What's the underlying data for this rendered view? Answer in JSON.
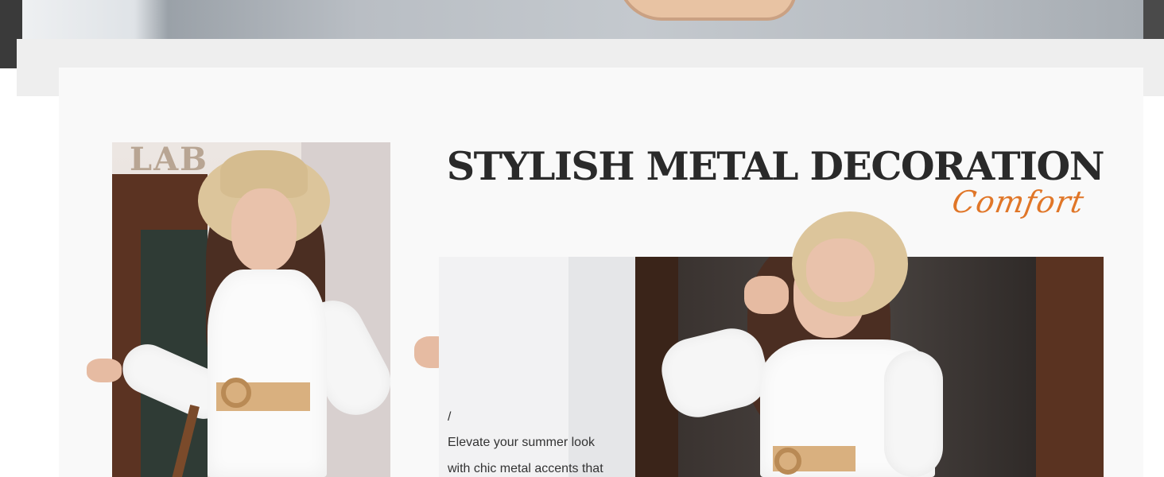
{
  "section": {
    "title": "STYLISH METAL DECORATION",
    "script_word": "Comfort",
    "description": {
      "marker": "/",
      "lines": [
        "Elevate your summer look",
        "with chic metal accents that"
      ]
    }
  },
  "images": {
    "left_sign": "LAB"
  },
  "colors": {
    "title": "#2a2a2a",
    "accent": "#e07628",
    "panel": "#f9f9f9",
    "band": "#eeeeee"
  }
}
